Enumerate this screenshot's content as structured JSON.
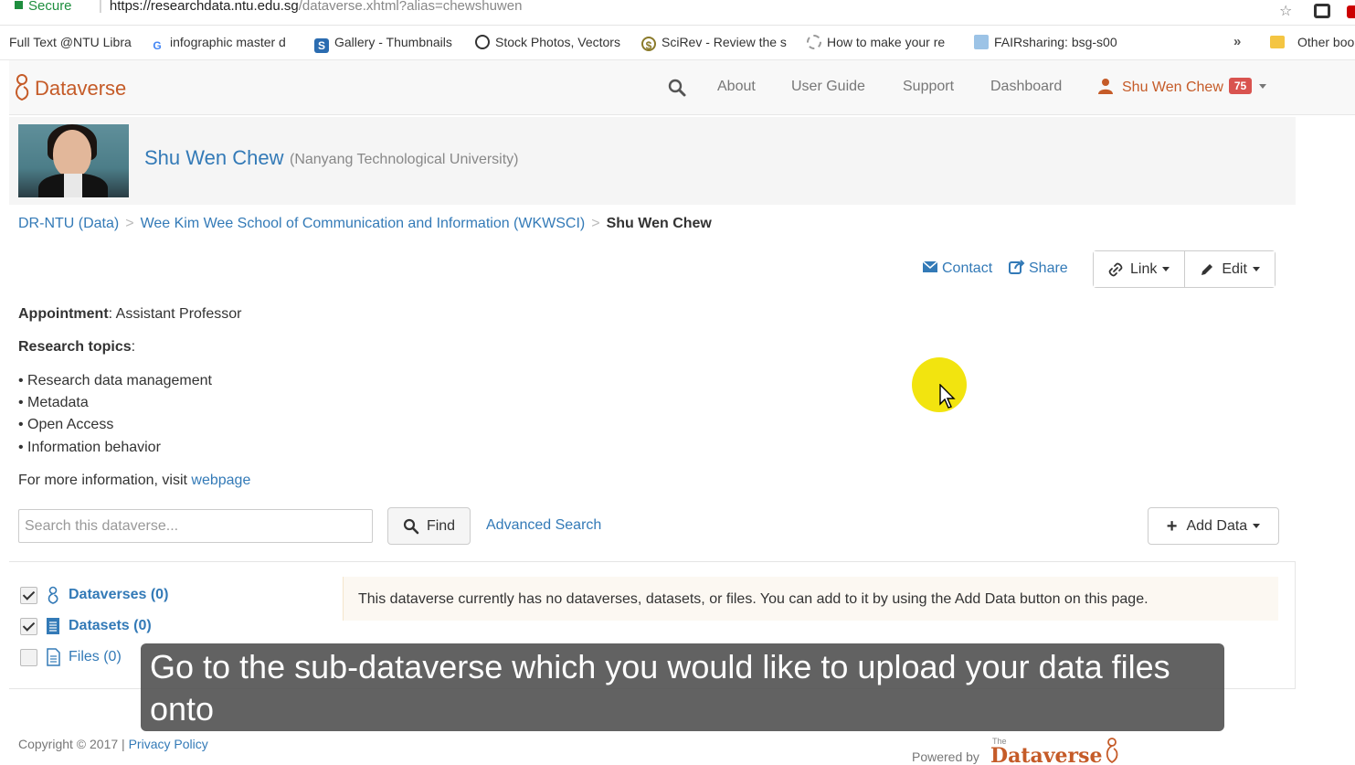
{
  "browser": {
    "secure_label": "Secure",
    "url_host": "https://researchdata.ntu.edu.sg",
    "url_rest": "/dataverse.xhtml?alias=chewshuwen",
    "bookmarks": [
      {
        "label": "Full Text @NTU Libra"
      },
      {
        "label": "infographic master d"
      },
      {
        "label": "Gallery - Thumbnails"
      },
      {
        "label": "Stock Photos, Vectors"
      },
      {
        "label": "SciRev - Review the s"
      },
      {
        "label": "How to make your re"
      },
      {
        "label": "FAIRsharing: bsg-s00"
      }
    ],
    "more": "»",
    "other_bookmarks": "Other boo"
  },
  "navbar": {
    "brand": "Dataverse",
    "links": [
      {
        "label": "About"
      },
      {
        "label": "User Guide"
      },
      {
        "label": "Support"
      },
      {
        "label": "Dashboard"
      }
    ],
    "user_name": "Shu Wen Chew",
    "notification_count": "75"
  },
  "header": {
    "name": "Shu Wen Chew",
    "affiliation": "(Nanyang Technological University)"
  },
  "breadcrumb": {
    "items": [
      {
        "label": "DR-NTU (Data)"
      },
      {
        "label": "Wee Kim Wee School of Communication and Information (WKWSCI)"
      }
    ],
    "current": "Shu Wen Chew",
    "separator": ">"
  },
  "actions": {
    "contact": "Contact",
    "share": "Share",
    "link": "Link",
    "edit": "Edit"
  },
  "description": {
    "appointment_label": "Appointment",
    "appointment_value": ": Assistant Professor",
    "topics_label": "Research topics",
    "topics_colon": ":",
    "topics": [
      "• Research data management",
      "• Metadata",
      "• Open Access",
      "• Information behavior"
    ],
    "more_info_prefix": "For more information, visit ",
    "more_info_link": "webpage"
  },
  "search": {
    "placeholder": "Search this dataverse...",
    "find_label": "Find",
    "advanced_label": "Advanced Search",
    "add_data_label": "Add Data"
  },
  "facets": [
    {
      "label": "Dataverses (0)",
      "checked": true
    },
    {
      "label": "Datasets (0)",
      "checked": true
    },
    {
      "label": "Files (0)",
      "checked": false
    }
  ],
  "empty_message": "This dataverse currently has no dataverses, datasets, or files. You can add to it by using the Add Data button on this page.",
  "caption": "Go to the sub-dataverse which you would like to upload your data files onto",
  "footer": {
    "copyright": "Copyright © 2017 | ",
    "privacy": "Privacy Policy",
    "powered_by": "Powered by",
    "logo_the": "The",
    "logo_word": "Dataverse"
  },
  "colors": {
    "brand": "#c55b28",
    "link": "#337ab7",
    "badge": "#d9534f",
    "cursor_highlight": "#f2e40f"
  }
}
